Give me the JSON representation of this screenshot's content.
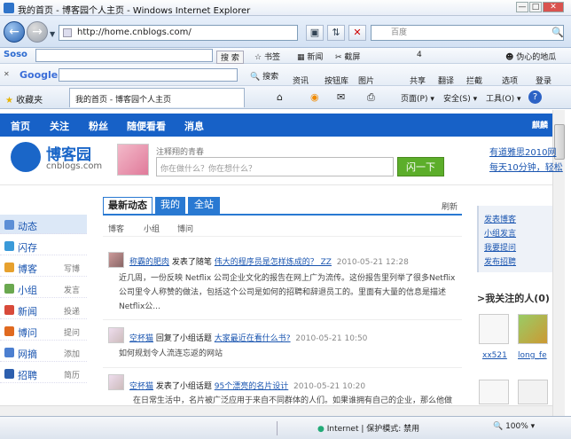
{
  "window": {
    "title": "我的首页 - 博客园个人主页 - Windows Internet Explorer",
    "min": "—",
    "max": "□",
    "close": "✕"
  },
  "address": {
    "url": "http://home.cnblogs.com/",
    "search_placeholder": "百度"
  },
  "soso": {
    "logo": "Soso",
    "search_btn": "搜 索",
    "items": [
      "书签",
      "新闻",
      "截屏",
      "伪心的地瓜"
    ],
    "count": "4"
  },
  "google": {
    "logo": "Google",
    "search": "搜索",
    "items": [
      "资讯",
      "按钮库",
      "图片",
      "共享",
      "翻译",
      "拦截",
      "选项",
      "登录"
    ]
  },
  "favbar": {
    "favorites": "收藏夹",
    "tab_title": "我的首页 - 博客园个人主页",
    "page": "页面(P)",
    "safety": "安全(S)",
    "tools": "工具(O)"
  },
  "site_nav": {
    "items": [
      "首页",
      "关注",
      "粉丝",
      "随便看看",
      "消息"
    ],
    "right": "麒麟"
  },
  "header": {
    "logo_title": "博客园",
    "logo_sub": "cnblogs.com",
    "mood_label": "注释翔的青春",
    "mood_placeholder": "你在做什么？你在想什么？",
    "go_button": "闪一下",
    "link1": "有道雅思2010网",
    "link2": "每天10分钟，轻松"
  },
  "left_nav": [
    {
      "label": "动态",
      "sub": ""
    },
    {
      "label": "闪存",
      "sub": ""
    },
    {
      "label": "博客",
      "sub": "写博"
    },
    {
      "label": "小组",
      "sub": "发言"
    },
    {
      "label": "新闻",
      "sub": "投递"
    },
    {
      "label": "博问",
      "sub": "提问"
    },
    {
      "label": "网摘",
      "sub": "添加"
    },
    {
      "label": "招聘",
      "sub": "简历"
    }
  ],
  "feed": {
    "tabs": [
      "最新动态",
      "我的",
      "全站"
    ],
    "refresh": "刷新",
    "subtabs": [
      "博客",
      "小组",
      "博问"
    ],
    "posts": [
      {
        "user": "称霸的肥肉",
        "action": "发表了随笔",
        "title": "伟大的程序员是怎样炼成的？ ZZ",
        "time": "2010-05-21 12:28",
        "body": "近几周，一份反映 Netflix 公司企业文化的报告在网上广为流传。这份报告里列举了很多Netflix公司里令人称赞的做法，包括这个公司是如何的招聘和辞退员工的。里面有大量的信息是描述Netflix公..."
      },
      {
        "user": "空杯猫",
        "action": "回复了小组话题",
        "title": "大家最近在看什么书?",
        "time": "2010-05-21 10:50",
        "body": "如何规划令人流连忘返的网站"
      },
      {
        "user": "空杯猫",
        "action": "发表了小组话题",
        "title": "95个漂亮的名片设计",
        "time": "2010-05-21 10:20",
        "body": "在日常生活中，名片被广泛应用于来自不同群体的人们。如果谁拥有自己的企业，那么他做"
      }
    ]
  },
  "right": {
    "links": [
      "发表博客",
      "小组发言",
      "我要提问",
      "发布招聘"
    ],
    "follow_title": ">我关注的人(0)",
    "people": [
      "xx521",
      "long_fe"
    ]
  },
  "status": {
    "zone": "Internet | 保护模式: 禁用",
    "zoom": "100%"
  }
}
